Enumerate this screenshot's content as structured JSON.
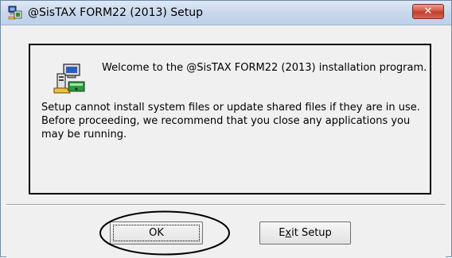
{
  "window": {
    "title": "@SisTAX FORM22 (2013) Setup",
    "close_glyph": "✕"
  },
  "panel": {
    "welcome": "Welcome to the @SisTAX FORM22 (2013) installation program.",
    "message": "Setup cannot install system files or update shared files if they are in use. Before proceeding, we recommend that you close any applications you may be running."
  },
  "buttons": {
    "ok_label": "OK",
    "exit_prefix": "E",
    "exit_mnemonic": "x",
    "exit_suffix": "it Setup"
  },
  "icons": {
    "title": "installer-computer-icon",
    "panel": "setup-computer-icon"
  },
  "colors": {
    "close_button": "#c0392b",
    "annotation": "#000000"
  }
}
